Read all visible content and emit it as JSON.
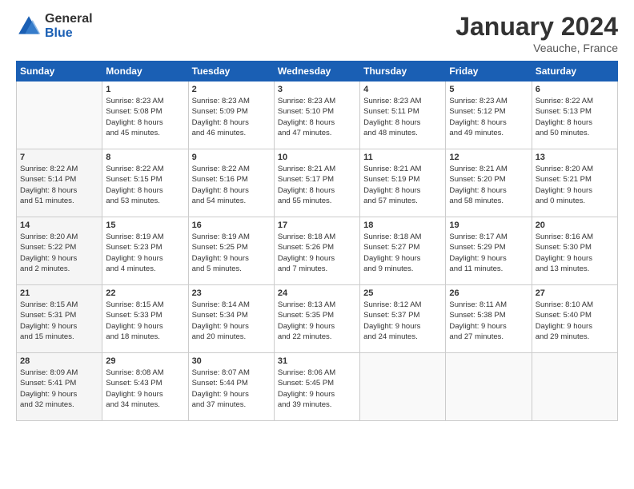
{
  "logo": {
    "general": "General",
    "blue": "Blue"
  },
  "header": {
    "month": "January 2024",
    "location": "Veauche, France"
  },
  "weekdays": [
    "Sunday",
    "Monday",
    "Tuesday",
    "Wednesday",
    "Thursday",
    "Friday",
    "Saturday"
  ],
  "weeks": [
    [
      {
        "day": null,
        "info": null
      },
      {
        "day": "1",
        "info": "Sunrise: 8:23 AM\nSunset: 5:08 PM\nDaylight: 8 hours\nand 45 minutes."
      },
      {
        "day": "2",
        "info": "Sunrise: 8:23 AM\nSunset: 5:09 PM\nDaylight: 8 hours\nand 46 minutes."
      },
      {
        "day": "3",
        "info": "Sunrise: 8:23 AM\nSunset: 5:10 PM\nDaylight: 8 hours\nand 47 minutes."
      },
      {
        "day": "4",
        "info": "Sunrise: 8:23 AM\nSunset: 5:11 PM\nDaylight: 8 hours\nand 48 minutes."
      },
      {
        "day": "5",
        "info": "Sunrise: 8:23 AM\nSunset: 5:12 PM\nDaylight: 8 hours\nand 49 minutes."
      },
      {
        "day": "6",
        "info": "Sunrise: 8:22 AM\nSunset: 5:13 PM\nDaylight: 8 hours\nand 50 minutes."
      }
    ],
    [
      {
        "day": "7",
        "info": "Sunrise: 8:22 AM\nSunset: 5:14 PM\nDaylight: 8 hours\nand 51 minutes."
      },
      {
        "day": "8",
        "info": "Sunrise: 8:22 AM\nSunset: 5:15 PM\nDaylight: 8 hours\nand 53 minutes."
      },
      {
        "day": "9",
        "info": "Sunrise: 8:22 AM\nSunset: 5:16 PM\nDaylight: 8 hours\nand 54 minutes."
      },
      {
        "day": "10",
        "info": "Sunrise: 8:21 AM\nSunset: 5:17 PM\nDaylight: 8 hours\nand 55 minutes."
      },
      {
        "day": "11",
        "info": "Sunrise: 8:21 AM\nSunset: 5:19 PM\nDaylight: 8 hours\nand 57 minutes."
      },
      {
        "day": "12",
        "info": "Sunrise: 8:21 AM\nSunset: 5:20 PM\nDaylight: 8 hours\nand 58 minutes."
      },
      {
        "day": "13",
        "info": "Sunrise: 8:20 AM\nSunset: 5:21 PM\nDaylight: 9 hours\nand 0 minutes."
      }
    ],
    [
      {
        "day": "14",
        "info": "Sunrise: 8:20 AM\nSunset: 5:22 PM\nDaylight: 9 hours\nand 2 minutes."
      },
      {
        "day": "15",
        "info": "Sunrise: 8:19 AM\nSunset: 5:23 PM\nDaylight: 9 hours\nand 4 minutes."
      },
      {
        "day": "16",
        "info": "Sunrise: 8:19 AM\nSunset: 5:25 PM\nDaylight: 9 hours\nand 5 minutes."
      },
      {
        "day": "17",
        "info": "Sunrise: 8:18 AM\nSunset: 5:26 PM\nDaylight: 9 hours\nand 7 minutes."
      },
      {
        "day": "18",
        "info": "Sunrise: 8:18 AM\nSunset: 5:27 PM\nDaylight: 9 hours\nand 9 minutes."
      },
      {
        "day": "19",
        "info": "Sunrise: 8:17 AM\nSunset: 5:29 PM\nDaylight: 9 hours\nand 11 minutes."
      },
      {
        "day": "20",
        "info": "Sunrise: 8:16 AM\nSunset: 5:30 PM\nDaylight: 9 hours\nand 13 minutes."
      }
    ],
    [
      {
        "day": "21",
        "info": "Sunrise: 8:15 AM\nSunset: 5:31 PM\nDaylight: 9 hours\nand 15 minutes."
      },
      {
        "day": "22",
        "info": "Sunrise: 8:15 AM\nSunset: 5:33 PM\nDaylight: 9 hours\nand 18 minutes."
      },
      {
        "day": "23",
        "info": "Sunrise: 8:14 AM\nSunset: 5:34 PM\nDaylight: 9 hours\nand 20 minutes."
      },
      {
        "day": "24",
        "info": "Sunrise: 8:13 AM\nSunset: 5:35 PM\nDaylight: 9 hours\nand 22 minutes."
      },
      {
        "day": "25",
        "info": "Sunrise: 8:12 AM\nSunset: 5:37 PM\nDaylight: 9 hours\nand 24 minutes."
      },
      {
        "day": "26",
        "info": "Sunrise: 8:11 AM\nSunset: 5:38 PM\nDaylight: 9 hours\nand 27 minutes."
      },
      {
        "day": "27",
        "info": "Sunrise: 8:10 AM\nSunset: 5:40 PM\nDaylight: 9 hours\nand 29 minutes."
      }
    ],
    [
      {
        "day": "28",
        "info": "Sunrise: 8:09 AM\nSunset: 5:41 PM\nDaylight: 9 hours\nand 32 minutes."
      },
      {
        "day": "29",
        "info": "Sunrise: 8:08 AM\nSunset: 5:43 PM\nDaylight: 9 hours\nand 34 minutes."
      },
      {
        "day": "30",
        "info": "Sunrise: 8:07 AM\nSunset: 5:44 PM\nDaylight: 9 hours\nand 37 minutes."
      },
      {
        "day": "31",
        "info": "Sunrise: 8:06 AM\nSunset: 5:45 PM\nDaylight: 9 hours\nand 39 minutes."
      },
      {
        "day": null,
        "info": null
      },
      {
        "day": null,
        "info": null
      },
      {
        "day": null,
        "info": null
      }
    ]
  ]
}
